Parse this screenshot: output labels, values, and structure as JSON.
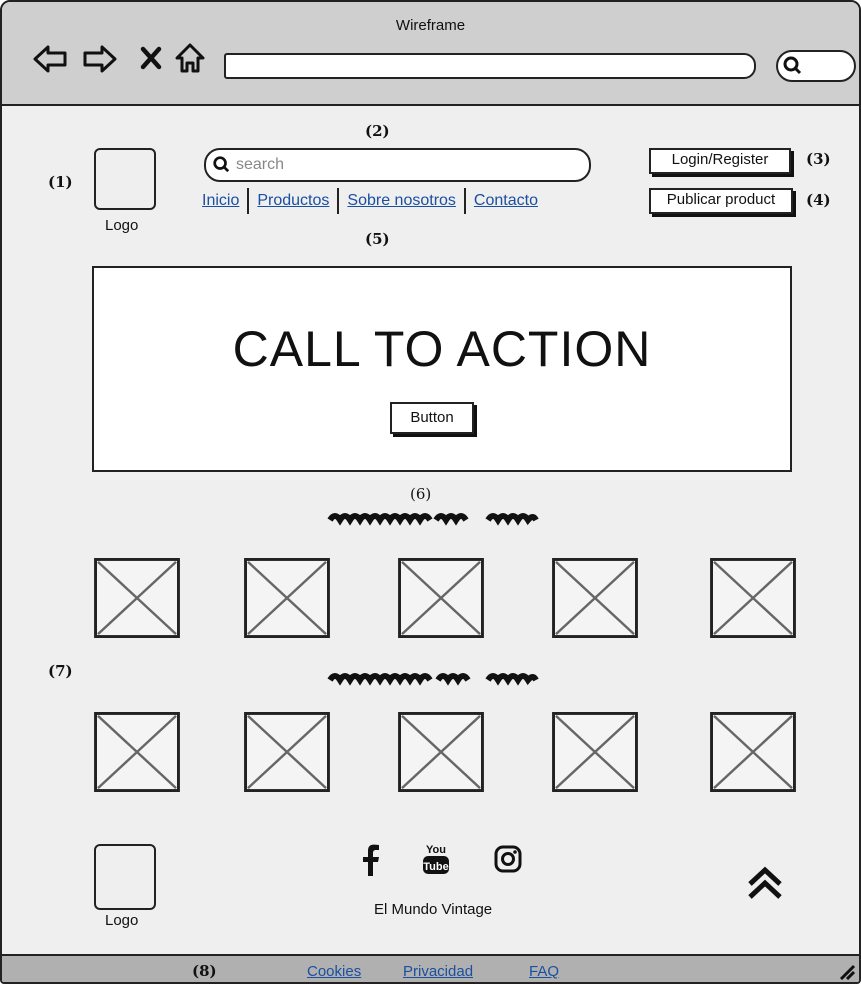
{
  "window": {
    "title": "Wireframe"
  },
  "toolbar": {
    "back_icon": "back-arrow-icon",
    "forward_icon": "forward-arrow-icon",
    "close_icon": "close-icon",
    "home_icon": "home-icon",
    "search_icon": "search-icon"
  },
  "annotations": {
    "a1": "(1)",
    "a2": "(2)",
    "a3": "(3)",
    "a4": "(4)",
    "a5": "(5)",
    "a6": "(6)",
    "a7": "(7)",
    "a8": "(8)"
  },
  "header": {
    "logo_label": "Logo",
    "search_placeholder": "search",
    "nav": [
      "Inicio",
      "Productos",
      "Sobre nosotros",
      "Contacto"
    ],
    "login_label": "Login/Register",
    "publish_label": "Publicar product"
  },
  "hero": {
    "title": "CALL TO ACTION",
    "button_label": "Button"
  },
  "products": {
    "row1_count": 5,
    "row2_count": 5
  },
  "footer": {
    "logo_label": "Logo",
    "social": [
      "facebook-icon",
      "youtube-icon",
      "instagram-icon"
    ],
    "brand": "El Mundo Vintage",
    "scroll_top_icon": "double-chevron-up-icon"
  },
  "bottom_links": [
    "Cookies",
    "Privacidad",
    "FAQ"
  ]
}
